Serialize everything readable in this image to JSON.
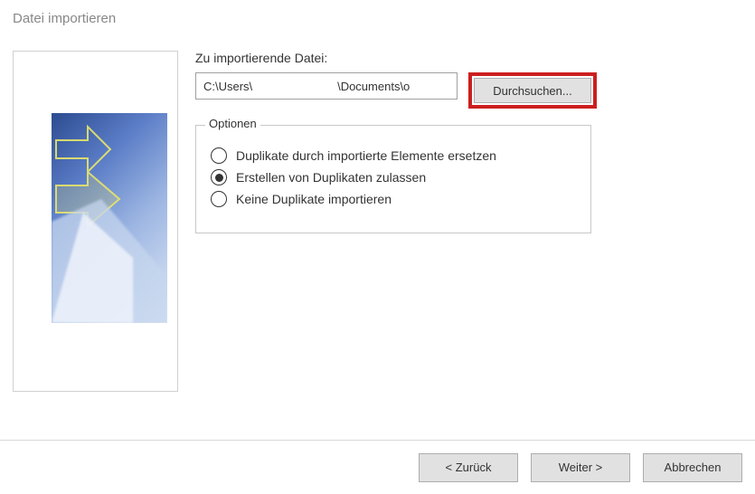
{
  "window": {
    "title": "Datei importieren"
  },
  "file": {
    "label": "Zu importierende Datei:",
    "value": "C:\\Users\\                          \\Documents\\o",
    "browse": "Durchsuchen..."
  },
  "options": {
    "title": "Optionen",
    "items": [
      {
        "label": "Duplikate durch importierte Elemente ersetzen",
        "checked": false
      },
      {
        "label": "Erstellen von Duplikaten zulassen",
        "checked": true
      },
      {
        "label": "Keine Duplikate importieren",
        "checked": false
      }
    ]
  },
  "footer": {
    "back": "<  Zurück",
    "next": "Weiter  >",
    "cancel": "Abbrechen"
  }
}
